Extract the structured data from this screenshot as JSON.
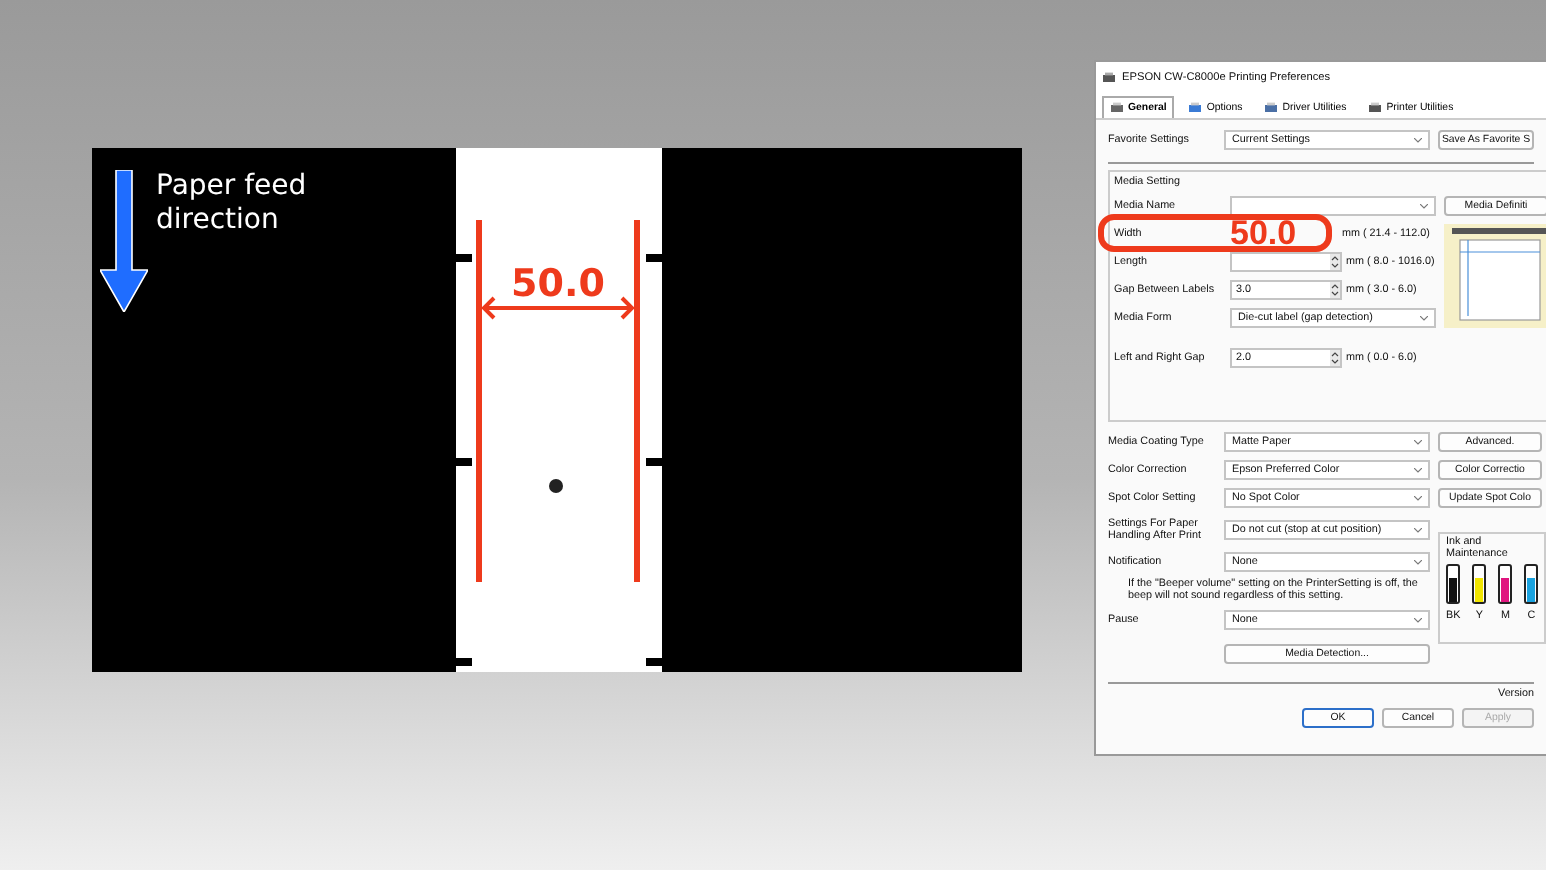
{
  "diagram": {
    "direction_label": "Paper feed direction",
    "dimension": "50.0"
  },
  "dialog": {
    "title": "EPSON CW-C8000e Printing Preferences",
    "tabs": [
      {
        "label": "General",
        "selected": true
      },
      {
        "label": "Options",
        "selected": false
      },
      {
        "label": "Driver Utilities",
        "selected": false
      },
      {
        "label": "Printer Utilities",
        "selected": false
      }
    ],
    "favorite": {
      "label": "Favorite Settings",
      "value": "Current Settings",
      "button": "Save As Favorite S"
    },
    "group_title": "Media Setting",
    "media_button": "Media Definiti",
    "media_rows": [
      {
        "kind": "select",
        "label": "Media Name"
      },
      {
        "kind": "highlight",
        "label": "Width",
        "highlight": "50.0",
        "range": "mm ( 21.4 - 112.0)"
      },
      {
        "kind": "spin",
        "label": "Length",
        "range": "mm ( 8.0 - 1016.0)"
      },
      {
        "kind": "spin",
        "label": "Gap Between Labels",
        "value": "3.0",
        "range": "mm ( 3.0 -  6.0)"
      },
      {
        "kind": "select",
        "label": "Media Form",
        "value": "Die-cut label (gap detection)"
      },
      {
        "kind": "spin",
        "label": "Left and Right Gap",
        "value": "2.0",
        "range": "mm ( 0.0 -  6.0)"
      }
    ],
    "settings": [
      {
        "label": "Media Coating Type",
        "value": "Matte Paper",
        "button": "Advanced."
      },
      {
        "label": "Color Correction",
        "value": "Epson Preferred Color",
        "button": "Color Correctio"
      },
      {
        "label": "Spot Color Setting",
        "value": "No Spot Color",
        "button": "Update Spot Colo"
      },
      {
        "label": "Settings For Paper Handling After Print",
        "value": "Do not cut (stop at cut position)"
      },
      {
        "label": "Notification",
        "value": "None"
      }
    ],
    "note": "If the \"Beeper volume\" setting on the PrinterSetting is off, the beep will not sound regardless of this setting.",
    "pause": {
      "label": "Pause",
      "value": "None"
    },
    "detect_button": "Media Detection...",
    "ink": {
      "title": "Ink and Maintenance",
      "tanks": [
        {
          "label": "BK",
          "color": "#111111"
        },
        {
          "label": "Y",
          "color": "#f2e600"
        },
        {
          "label": "M",
          "color": "#e0157f"
        },
        {
          "label": "C",
          "color": "#1aa3e0"
        }
      ]
    },
    "version": "Version",
    "buttons": [
      {
        "label": "OK",
        "default": true,
        "disabled": false
      },
      {
        "label": "Cancel",
        "default": false,
        "disabled": false
      },
      {
        "label": "Apply",
        "default": false,
        "disabled": true
      }
    ]
  }
}
